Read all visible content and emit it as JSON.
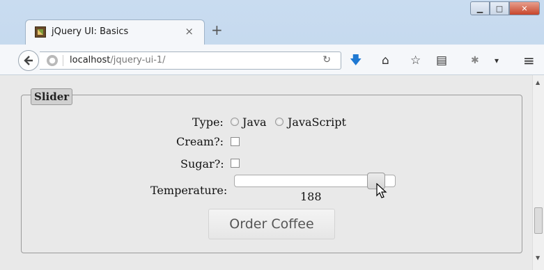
{
  "browser": {
    "tab_title": "jQuery UI: Basics",
    "url_host": "localhost",
    "url_path": "/jquery-ui-1/",
    "icons": [
      "back-arrow-icon",
      "globe-icon",
      "reload-icon",
      "download-icon",
      "home-icon",
      "bookmark-star-icon",
      "reading-list-icon",
      "addon-icon",
      "dropdown-icon",
      "hamburger-menu-icon"
    ]
  },
  "form": {
    "legend": "Slider",
    "type_label": "Type:",
    "type_options": [
      "Java",
      "JavaScript"
    ],
    "cream_label": "Cream?:",
    "sugar_label": "Sugar?:",
    "temperature_label": "Temperature:",
    "temperature_value": "188",
    "temperature_fraction": 0.88,
    "order_button": "Order Coffee"
  }
}
